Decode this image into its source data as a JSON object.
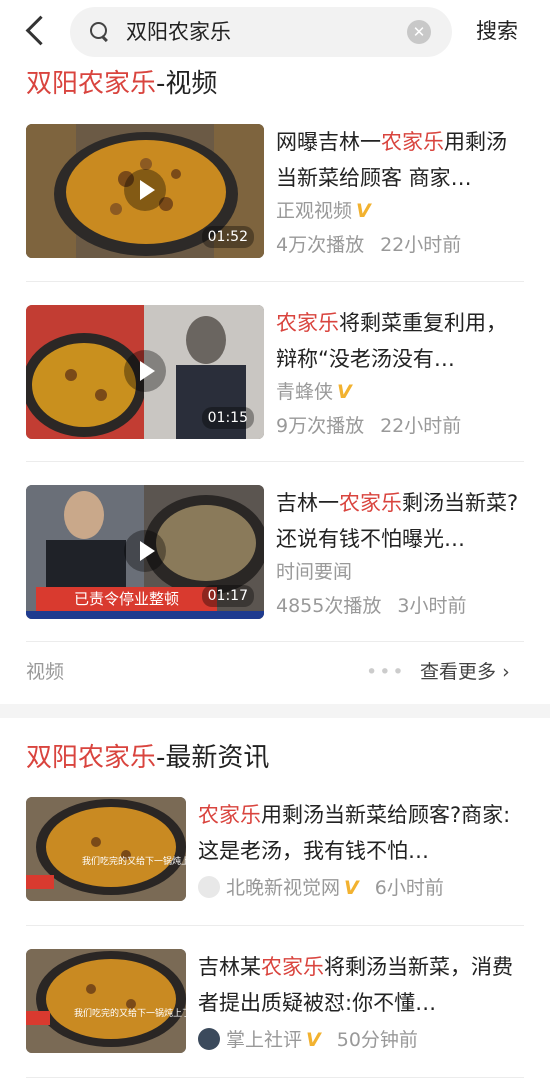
{
  "search": {
    "query": "双阳农家乐",
    "button_label": "搜索"
  },
  "video_section": {
    "title_keyword": "双阳农家乐",
    "title_suffix": "-视频",
    "items": [
      {
        "title_pre": "网曝吉林一",
        "title_keyword": "农家乐",
        "title_post": "用剩汤当新菜给顾客 商家…",
        "source": "正观视频",
        "verified": "V",
        "plays": "4万次播放",
        "time": "22小时前",
        "duration": "01:52"
      },
      {
        "title_pre": "",
        "title_keyword": "农家乐",
        "title_post": "将剩菜重复利用，辩称“没老汤没有…",
        "source": "青蜂侠",
        "verified": "V",
        "plays": "9万次播放",
        "time": "22小时前",
        "duration": "01:15"
      },
      {
        "title_pre": "吉林一",
        "title_keyword": "农家乐",
        "title_post": "剩汤当新菜?还说有钱不怕曝光…",
        "source": "时间要闻",
        "verified": "",
        "plays": "4855次播放",
        "time": "3小时前",
        "duration": "01:17",
        "overlay_caption": "已责令停业整顿"
      }
    ],
    "footer_label": "视频",
    "more_dots": "•••",
    "more_label": "查看更多"
  },
  "news_section": {
    "title_keyword": "双阳农家乐",
    "title_suffix": "-最新资讯",
    "items": [
      {
        "title_pre": "",
        "title_keyword": "农家乐",
        "title_post": "用剩汤当新菜给顾客?商家:这是老汤，我有钱不怕…",
        "source": "北晚新视觉网",
        "verified": "V",
        "time": "6小时前",
        "thumb_caption": "我们吃完的又给下一锅炖上了"
      },
      {
        "title_pre": "吉林某",
        "title_keyword": "农家乐",
        "title_post": "将剩汤当新菜，消费者提出质疑被怼:你不懂…",
        "source": "掌上社评",
        "verified": "V",
        "time": "50分钟前",
        "thumb_caption": "我们吃完的又给下一锅炖上了"
      }
    ]
  },
  "colors": {
    "highlight": "#d9443e",
    "verified": "#f2b230",
    "meta_text": "#999999"
  }
}
